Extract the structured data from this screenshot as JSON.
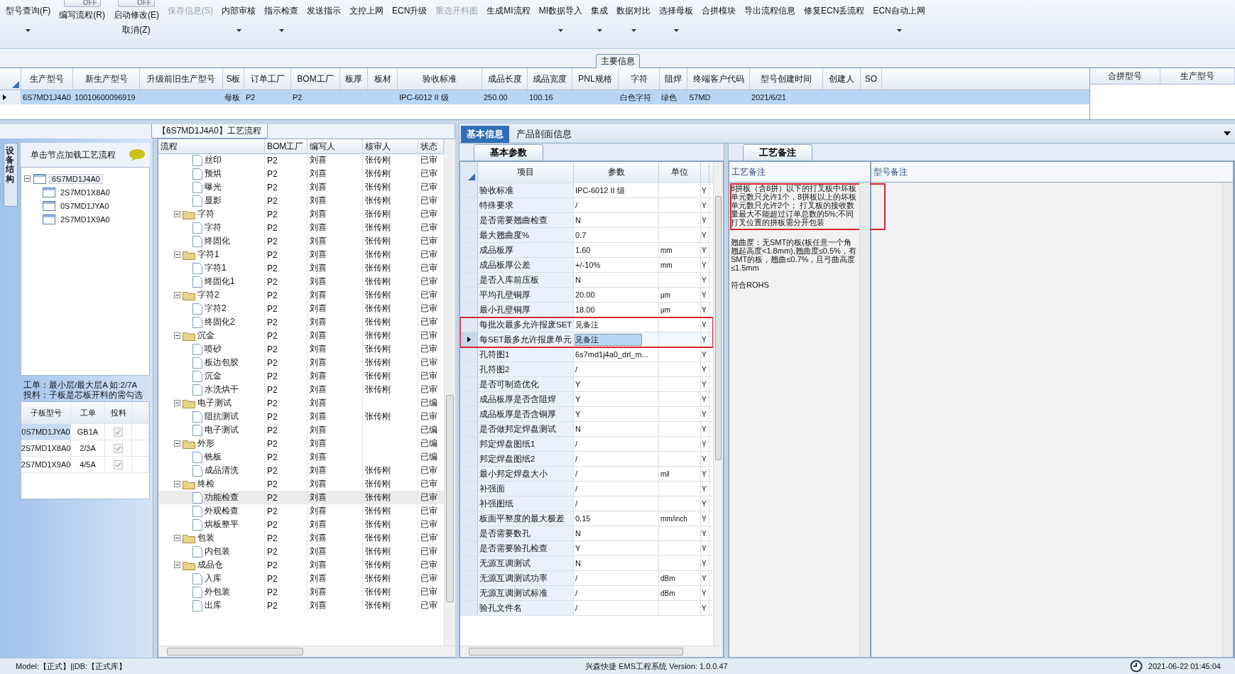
{
  "toolbar": [
    {
      "kind": "button",
      "label": "型号查询(F)",
      "disabled": false,
      "dropdown": true
    },
    {
      "kind": "toggle",
      "switch": "OFF",
      "on": false,
      "label": "编写流程(R)"
    },
    {
      "kind": "toggle",
      "switch": "OFF",
      "on": false,
      "label": "启动修改(E)",
      "sublabel": "取消(Z)"
    },
    {
      "kind": "button",
      "label": "保存信息(S)",
      "disabled": true,
      "dropdown": false
    },
    {
      "kind": "button",
      "label": "内部审核",
      "disabled": false,
      "dropdown": true
    },
    {
      "kind": "button",
      "label": "指示检查",
      "disabled": false,
      "dropdown": true
    },
    {
      "kind": "button",
      "label": "发送指示",
      "disabled": false,
      "dropdown": false
    },
    {
      "kind": "button",
      "label": "文控上网",
      "disabled": false,
      "dropdown": false
    },
    {
      "kind": "button",
      "label": "ECN升级",
      "disabled": false,
      "dropdown": false
    },
    {
      "kind": "button",
      "label": "重选开料图",
      "disabled": true,
      "dropdown": false
    },
    {
      "kind": "button",
      "label": "生成MI流程",
      "disabled": false,
      "dropdown": false
    },
    {
      "kind": "button",
      "label": "MI数据导入",
      "disabled": false,
      "dropdown": true
    },
    {
      "kind": "button",
      "label": "集成",
      "disabled": false,
      "dropdown": true
    },
    {
      "kind": "button",
      "label": "数据对比",
      "disabled": false,
      "dropdown": true
    },
    {
      "kind": "button",
      "label": "选择母板",
      "disabled": false,
      "dropdown": true
    },
    {
      "kind": "button",
      "label": "合拼模块",
      "disabled": false,
      "dropdown": false
    },
    {
      "kind": "button",
      "label": "导出流程信息",
      "disabled": false,
      "dropdown": false
    },
    {
      "kind": "button",
      "label": "修复ECN丢流程",
      "disabled": false,
      "dropdown": false
    },
    {
      "kind": "button",
      "label": "ECN自动上网",
      "disabled": false,
      "dropdown": true
    }
  ],
  "main_info": {
    "title": "主要信息",
    "columns": [
      "生产型号",
      "新生产型号",
      "升级前旧生产型号",
      "S板",
      "订单工厂",
      "BOM工厂",
      "板厚",
      "板材",
      "验收标准",
      "成品长度",
      "成品宽度",
      "PNL规格",
      "字符",
      "阻焊",
      "终端客户代码",
      "型号创建时间",
      "创建人",
      "SO"
    ],
    "rows": [
      {
        "selected": true,
        "current": true,
        "cells": [
          "6S7MD1J4A0",
          "10010600096919",
          null,
          "母板",
          "P2",
          "P2",
          null,
          null,
          "IPC-6012 II 级",
          "250.00",
          "100.16",
          null,
          "白色字符",
          "绿色",
          "S7MD",
          "2021/6/21",
          null,
          null
        ]
      }
    ]
  },
  "merge_table": {
    "columns": [
      "合拼型号",
      "生产型号"
    ]
  },
  "process": {
    "title": "【6S7MD1J4A0】工艺流程"
  },
  "equipment": {
    "tab": "设备结构",
    "hint": "单击节点加载工艺流程",
    "tree": [
      {
        "label": "6S7MD1J4A0",
        "expanded": true,
        "selected": true,
        "children": [
          {
            "label": "2S7MD1X8A0",
            "selected": false
          },
          {
            "label": "0S7MD1JYA0",
            "selected": false
          },
          {
            "label": "2S7MD1X9A0",
            "selected": false
          }
        ]
      }
    ],
    "notes": [
      "工单：最小层/最大层A 如:2/7A",
      "投料：子板是芯板开料的需勾选"
    ],
    "sub_table": {
      "columns": [
        "子板型号",
        "工单",
        "投料"
      ],
      "rows": [
        {
          "model": "0S7MD1JYA0",
          "order": "GB1A",
          "feed": true,
          "selected": true
        },
        {
          "model": "2S7MD1X8A0",
          "order": "2/3A",
          "feed": true,
          "selected": false
        },
        {
          "model": "2S7MD1X9A0",
          "order": "4/5A",
          "feed": true,
          "selected": false
        }
      ]
    }
  },
  "process_tree": {
    "columns": [
      "流程",
      "BOM工厂",
      "编写人",
      "核审人",
      "状态"
    ],
    "nodes": [
      {
        "kind": "leaf",
        "name": "丝印",
        "bom": "P2",
        "writer": "刘喜",
        "reviewer": "张传刚",
        "status": "已审",
        "selected": false
      },
      {
        "kind": "leaf",
        "name": "预烘",
        "bom": "P2",
        "writer": "刘喜",
        "reviewer": "张传刚",
        "status": "已审",
        "selected": false
      },
      {
        "kind": "leaf",
        "name": "曝光",
        "bom": "P2",
        "writer": "刘喜",
        "reviewer": "张传刚",
        "status": "已审",
        "selected": false
      },
      {
        "kind": "leaf",
        "name": "显影",
        "bom": "P2",
        "writer": "刘喜",
        "reviewer": "张传刚",
        "status": "已审",
        "selected": false
      },
      {
        "kind": "folder",
        "name": "字符",
        "bom": "P2",
        "writer": "刘喜",
        "reviewer": "张传刚",
        "status": "已审",
        "selected": false,
        "expanded": true,
        "children": [
          {
            "kind": "leaf",
            "name": "字符",
            "bom": "P2",
            "writer": "刘喜",
            "reviewer": "张传刚",
            "status": "已审",
            "selected": false
          },
          {
            "kind": "leaf",
            "name": "终固化",
            "bom": "P2",
            "writer": "刘喜",
            "reviewer": "张传刚",
            "status": "已审",
            "selected": false
          }
        ]
      },
      {
        "kind": "folder",
        "name": "字符1",
        "bom": "P2",
        "writer": "刘喜",
        "reviewer": "张传刚",
        "status": "已审",
        "selected": false,
        "expanded": true,
        "children": [
          {
            "kind": "leaf",
            "name": "字符1",
            "bom": "P2",
            "writer": "刘喜",
            "reviewer": "张传刚",
            "status": "已审",
            "selected": false
          },
          {
            "kind": "leaf",
            "name": "终固化1",
            "bom": "P2",
            "writer": "刘喜",
            "reviewer": "张传刚",
            "status": "已审",
            "selected": false
          }
        ]
      },
      {
        "kind": "folder",
        "name": "字符2",
        "bom": "P2",
        "writer": "刘喜",
        "reviewer": "张传刚",
        "status": "已审",
        "selected": false,
        "expanded": true,
        "children": [
          {
            "kind": "leaf",
            "name": "字符2",
            "bom": "P2",
            "writer": "刘喜",
            "reviewer": "张传刚",
            "status": "已审",
            "selected": false
          },
          {
            "kind": "leaf",
            "name": "终固化2",
            "bom": "P2",
            "writer": "刘喜",
            "reviewer": "张传刚",
            "status": "已审",
            "selected": false
          }
        ]
      },
      {
        "kind": "folder",
        "name": "沉金",
        "bom": "P2",
        "writer": "刘喜",
        "reviewer": "张传刚",
        "status": "已审",
        "selected": false,
        "expanded": true,
        "children": [
          {
            "kind": "leaf",
            "name": "喷砂",
            "bom": "P2",
            "writer": "刘喜",
            "reviewer": "张传刚",
            "status": "已审",
            "selected": false
          },
          {
            "kind": "leaf",
            "name": "板边包胶",
            "bom": "P2",
            "writer": "刘喜",
            "reviewer": "张传刚",
            "status": "已审",
            "selected": false
          },
          {
            "kind": "leaf",
            "name": "沉金",
            "bom": "P2",
            "writer": "刘喜",
            "reviewer": "张传刚",
            "status": "已审",
            "selected": false
          },
          {
            "kind": "leaf",
            "name": "水洗烘干",
            "bom": "P2",
            "writer": "刘喜",
            "reviewer": "张传刚",
            "status": "已审",
            "selected": false
          }
        ]
      },
      {
        "kind": "folder",
        "name": "电子测试",
        "bom": "P2",
        "writer": "刘喜",
        "status": "已编",
        "selected": false,
        "expanded": true,
        "children": [
          {
            "kind": "leaf",
            "name": "阻抗测试",
            "bom": "P2",
            "writer": "刘喜",
            "reviewer": "张传刚",
            "status": "已审",
            "selected": false
          },
          {
            "kind": "leaf",
            "name": "电子测试",
            "bom": "P2",
            "writer": "刘喜",
            "status": "已编",
            "selected": false
          }
        ]
      },
      {
        "kind": "folder",
        "name": "外形",
        "bom": "P2",
        "writer": "刘喜",
        "status": "已编",
        "selected": false,
        "expanded": true,
        "children": [
          {
            "kind": "leaf",
            "name": "铣板",
            "bom": "P2",
            "writer": "刘喜",
            "status": "已编",
            "selected": false
          },
          {
            "kind": "leaf",
            "name": "成品清洗",
            "bom": "P2",
            "writer": "刘喜",
            "reviewer": "张传刚",
            "status": "已审",
            "selected": false
          }
        ]
      },
      {
        "kind": "folder",
        "name": "终检",
        "bom": "P2",
        "writer": "刘喜",
        "reviewer": "张传刚",
        "status": "已审",
        "selected": false,
        "expanded": true,
        "children": [
          {
            "kind": "leaf",
            "name": "功能检查",
            "bom": "P2",
            "writer": "刘喜",
            "reviewer": "张传刚",
            "status": "已审",
            "selected": true
          },
          {
            "kind": "leaf",
            "name": "外观检查",
            "bom": "P2",
            "writer": "刘喜",
            "reviewer": "张传刚",
            "status": "已审",
            "selected": false
          },
          {
            "kind": "leaf",
            "name": "烘板整平",
            "bom": "P2",
            "writer": "刘喜",
            "reviewer": "张传刚",
            "status": "已审",
            "selected": false
          }
        ]
      },
      {
        "kind": "folder",
        "name": "包装",
        "bom": "P2",
        "writer": "刘喜",
        "reviewer": "张传刚",
        "status": "已审",
        "selected": false,
        "expanded": true,
        "children": [
          {
            "kind": "leaf",
            "name": "内包装",
            "bom": "P2",
            "writer": "刘喜",
            "reviewer": "张传刚",
            "status": "已审",
            "selected": false
          }
        ]
      },
      {
        "kind": "folder",
        "name": "成品仓",
        "bom": "P2",
        "writer": "刘喜",
        "reviewer": "张传刚",
        "status": "已审",
        "selected": false,
        "expanded": true,
        "children": [
          {
            "kind": "leaf",
            "name": "入库",
            "bom": "P2",
            "writer": "刘喜",
            "reviewer": "张传刚",
            "status": "已审",
            "selected": false
          },
          {
            "kind": "leaf",
            "name": "外包装",
            "bom": "P2",
            "writer": "刘喜",
            "reviewer": "张传刚",
            "status": "已审",
            "selected": false
          },
          {
            "kind": "leaf",
            "name": "出库",
            "bom": "P2",
            "writer": "刘喜",
            "reviewer": "张传刚",
            "status": "已审",
            "selected": false
          }
        ]
      }
    ]
  },
  "params": {
    "tabs": [
      {
        "label": "基本信息",
        "selected": true
      },
      {
        "label": "产品剖面信息",
        "selected": false
      }
    ],
    "subtab": "基本参数",
    "columns": [
      "项目",
      "参数",
      "单位"
    ],
    "rows": [
      {
        "item": "验收标准",
        "value": "IPC-6012 II 级",
        "column_4": "Y",
        "current": false,
        "marked": false
      },
      {
        "item": "特殊要求",
        "value": "/",
        "column_4": "Y",
        "current": false,
        "marked": false
      },
      {
        "item": "是否需要翘曲检查",
        "value": "N",
        "column_4": "Y",
        "current": false,
        "marked": false
      },
      {
        "item": "最大翘曲度%",
        "value": "0.7",
        "column_4": "Y",
        "current": false,
        "marked": false
      },
      {
        "item": "成品板厚",
        "value": "1.60",
        "unit": "mm",
        "column_4": "Y",
        "current": false,
        "marked": false
      },
      {
        "item": "成品板厚公差",
        "value": "+/-10%",
        "unit": "mm",
        "column_4": "Y",
        "current": false,
        "marked": false
      },
      {
        "item": "是否入库前压板",
        "value": "N",
        "column_4": "Y",
        "current": false,
        "marked": false
      },
      {
        "item": "平均孔壁铜厚",
        "value": "20.00",
        "unit": "μm",
        "column_4": "Y",
        "current": false,
        "marked": false
      },
      {
        "item": "最小孔壁铜厚",
        "value": "18.00",
        "unit": "μm",
        "column_4": "Y",
        "current": false,
        "marked": false
      },
      {
        "item": "每批次最多允许报废SET",
        "value": "见备注",
        "column_4": "Y",
        "current": false,
        "marked": true
      },
      {
        "item": "每SET最多允许报废单元",
        "value": "见备注",
        "column_4": "Y",
        "current": true,
        "marked": true
      },
      {
        "item": "孔符图1",
        "value": "6s7md1j4a0_drl_m...",
        "column_4": "Y",
        "current": false,
        "marked": false
      },
      {
        "item": "孔符图2",
        "value": "/",
        "column_4": "Y",
        "current": false,
        "marked": false
      },
      {
        "item": "是否可制造优化",
        "value": "Y",
        "column_4": "Y",
        "current": false,
        "marked": false
      },
      {
        "item": "成品板厚是否含阻焊",
        "value": "Y",
        "column_4": "Y",
        "current": false,
        "marked": false
      },
      {
        "item": "成品板厚是否含铜厚",
        "value": "Y",
        "column_4": "Y",
        "current": false,
        "marked": false
      },
      {
        "item": "是否做邦定焊盘测试",
        "value": "N",
        "column_4": "Y",
        "current": false,
        "marked": false
      },
      {
        "item": "邦定焊盘图纸1",
        "value": "/",
        "column_4": "Y",
        "current": false,
        "marked": false
      },
      {
        "item": "邦定焊盘图纸2",
        "value": "/",
        "column_4": "Y",
        "current": false,
        "marked": false
      },
      {
        "item": "最小邦定焊盘大小",
        "value": "/",
        "unit": "mil",
        "column_4": "Y",
        "current": false,
        "marked": false
      },
      {
        "item": "补强面",
        "value": "/",
        "column_4": "Y",
        "current": false,
        "marked": false
      },
      {
        "item": "补强图纸",
        "value": "/",
        "column_4": "Y",
        "current": false,
        "marked": false
      },
      {
        "item": "板面平整度的最大极差",
        "value": "0.15",
        "unit": "mm/inch",
        "column_4": "Y",
        "current": false,
        "marked": false
      },
      {
        "item": "是否需要数孔",
        "value": "N",
        "column_4": "Y",
        "current": false,
        "marked": false
      },
      {
        "item": "是否需要验孔检查",
        "value": "Y",
        "column_4": "Y",
        "current": false,
        "marked": false
      },
      {
        "item": "无源互调测试",
        "value": "N",
        "column_4": "Y",
        "current": false,
        "marked": false
      },
      {
        "item": "无源互调测试功率",
        "value": "/",
        "unit": "dBm",
        "column_4": "Y",
        "current": false,
        "marked": false
      },
      {
        "item": "无源互调测试标准",
        "value": "/",
        "unit": "dBm",
        "column_4": "Y",
        "current": false,
        "marked": false
      },
      {
        "item": "验孔文件名",
        "value": "/",
        "column_4": "Y",
        "current": false,
        "marked": false
      }
    ]
  },
  "notes": {
    "tab": "工艺备注",
    "columns": [
      "工艺备注",
      "型号备注"
    ],
    "paragraphs": [
      {
        "text": "8拼板（含8拼）以下的打叉板中坏板单元数只允许1个，8拼板以上的坏板单元数只允许2个；  打叉板的接收数量最大不能超过订单总数的5%;不同打叉位置的拼板需分开包装",
        "marked": true
      },
      {
        "text": "翘曲度：无SMT的板(板任意一个角翘起高度<1.8mm),翘曲度≤0.5%，有SMT的板，翘曲≤0.7%，且弓曲高度≤1.5mm",
        "marked": false
      },
      {
        "text": "符合ROHS",
        "marked": false
      }
    ]
  },
  "status_bar": {
    "left": "Model:【正式】||DB:【正式库】",
    "center": "兴森快捷 EMS工程系统 Version: 1.0.0.47",
    "time": "2021-06-22 01:45:04"
  }
}
